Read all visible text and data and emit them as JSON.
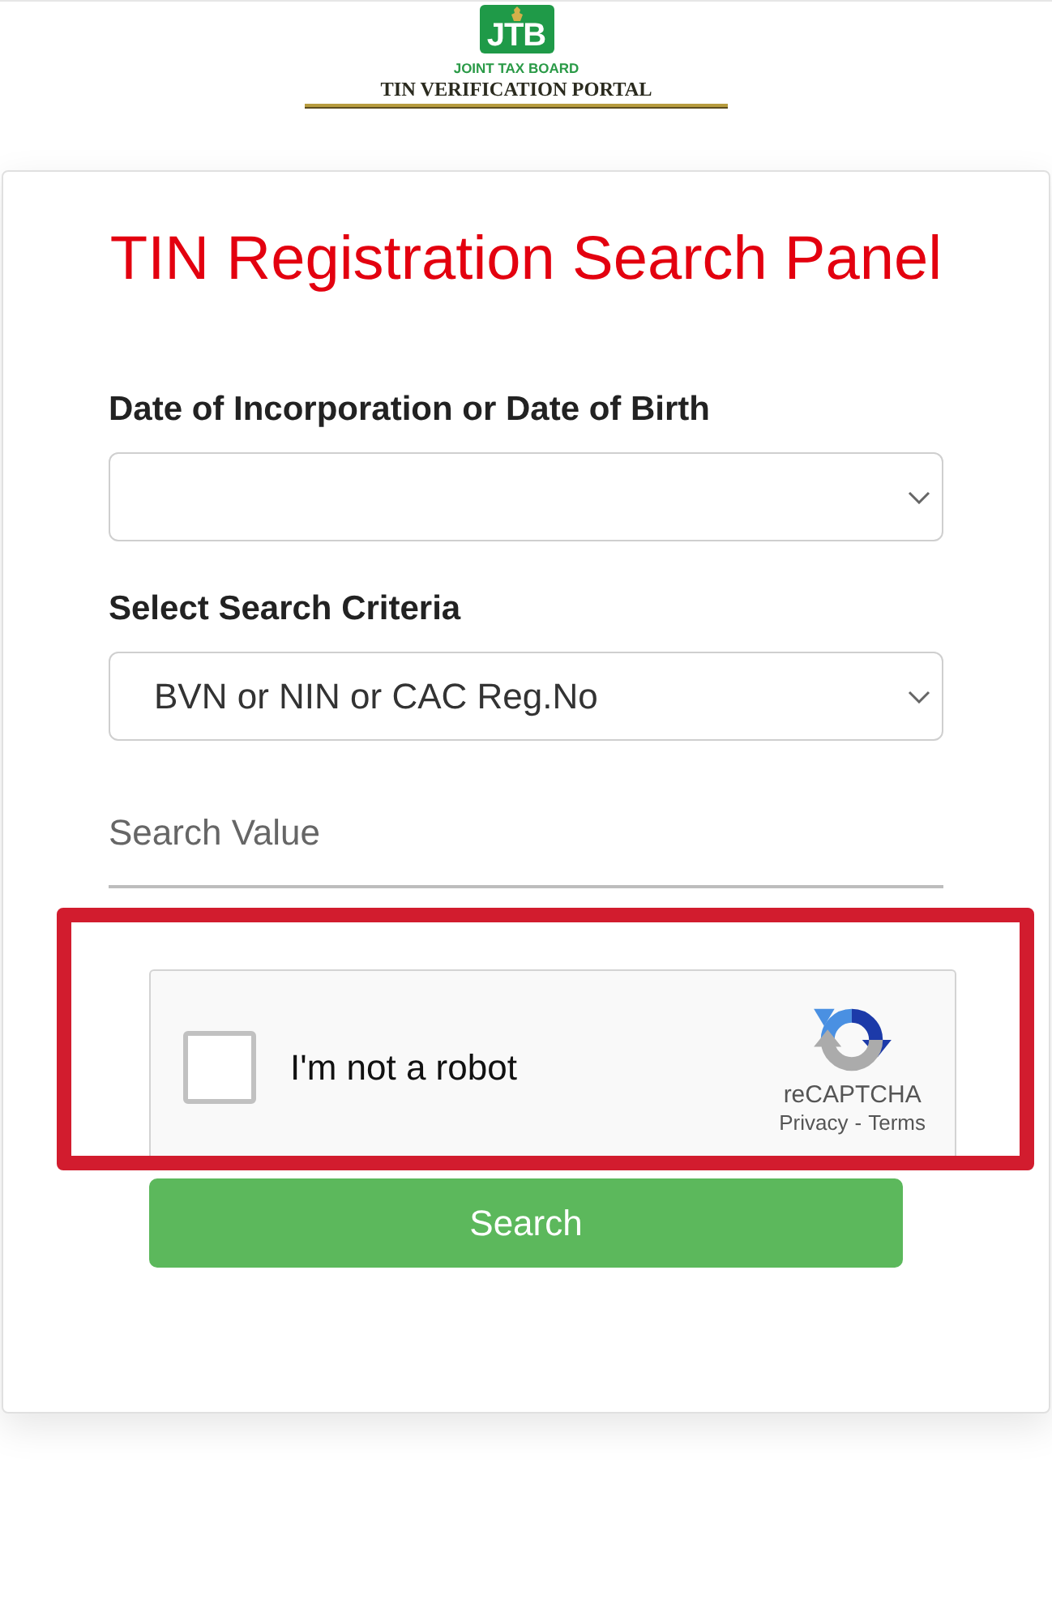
{
  "header": {
    "logo_mark": "JTB",
    "organization": "JOINT TAX BOARD",
    "portal_title": "TIN VERIFICATION PORTAL"
  },
  "panel": {
    "title": "TIN Registration Search Panel",
    "fields": [
      {
        "kind": "select",
        "label": "Date of Incorporation or Date of Birth"
      },
      {
        "kind": "select",
        "label": "Select Search Criteria",
        "value": "BVN or NIN or CAC Reg.No"
      },
      {
        "kind": "text",
        "placeholder": "Search Value"
      }
    ],
    "recaptcha": {
      "highlighted": true,
      "checked": false,
      "label": "I'm not a robot",
      "brand": "reCAPTCHA",
      "links": [
        "Privacy",
        "Terms"
      ],
      "link_separator": "-"
    },
    "submit": {
      "label": "Search"
    }
  }
}
